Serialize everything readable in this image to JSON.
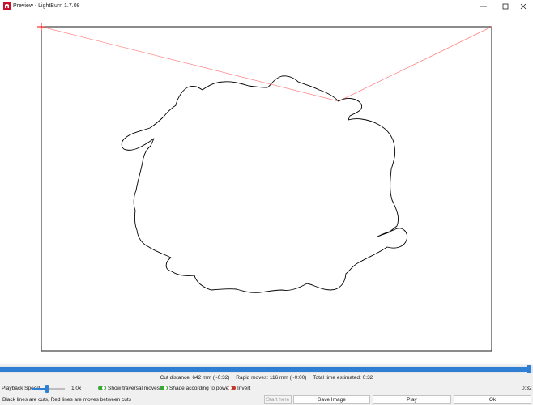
{
  "window": {
    "title": "Preview - LightBurn 1.7.08",
    "app_icon": "lightburn-icon",
    "controls": [
      "minimize-icon",
      "maximize-icon",
      "close-icon"
    ]
  },
  "preview": {
    "cut_color": "#000000",
    "rapid_color": "#ff8080",
    "origin_marker_color": "#ff0000"
  },
  "playback_progress": 1.0,
  "stats": {
    "cut_distance": "Cut distance: 642 mm (~0:32)",
    "rapid_moves": "Rapid moves: 116 mm (~0:00)",
    "total_time": "Total time estimated: 0:32"
  },
  "controls": {
    "playback_label": "Playback Speed",
    "playback_value": "1.0x",
    "playback_level": 0.45,
    "show_traversal": {
      "label": "Show traversal moves",
      "on": true
    },
    "shade_power": {
      "label": "Shade according to power",
      "on": true
    },
    "invert": {
      "label": "Invert",
      "on": false
    },
    "elapsed": "0:32"
  },
  "status_hint": "Black lines are cuts, Red lines are moves between cuts",
  "buttons": {
    "start_here": "Start here",
    "save_image": "Save Image",
    "play": "Play",
    "ok": "Ok"
  },
  "colors": {
    "accent": "#2f7fd4",
    "toggle_on": "#3aa635",
    "toggle_off": "#c0392b"
  }
}
